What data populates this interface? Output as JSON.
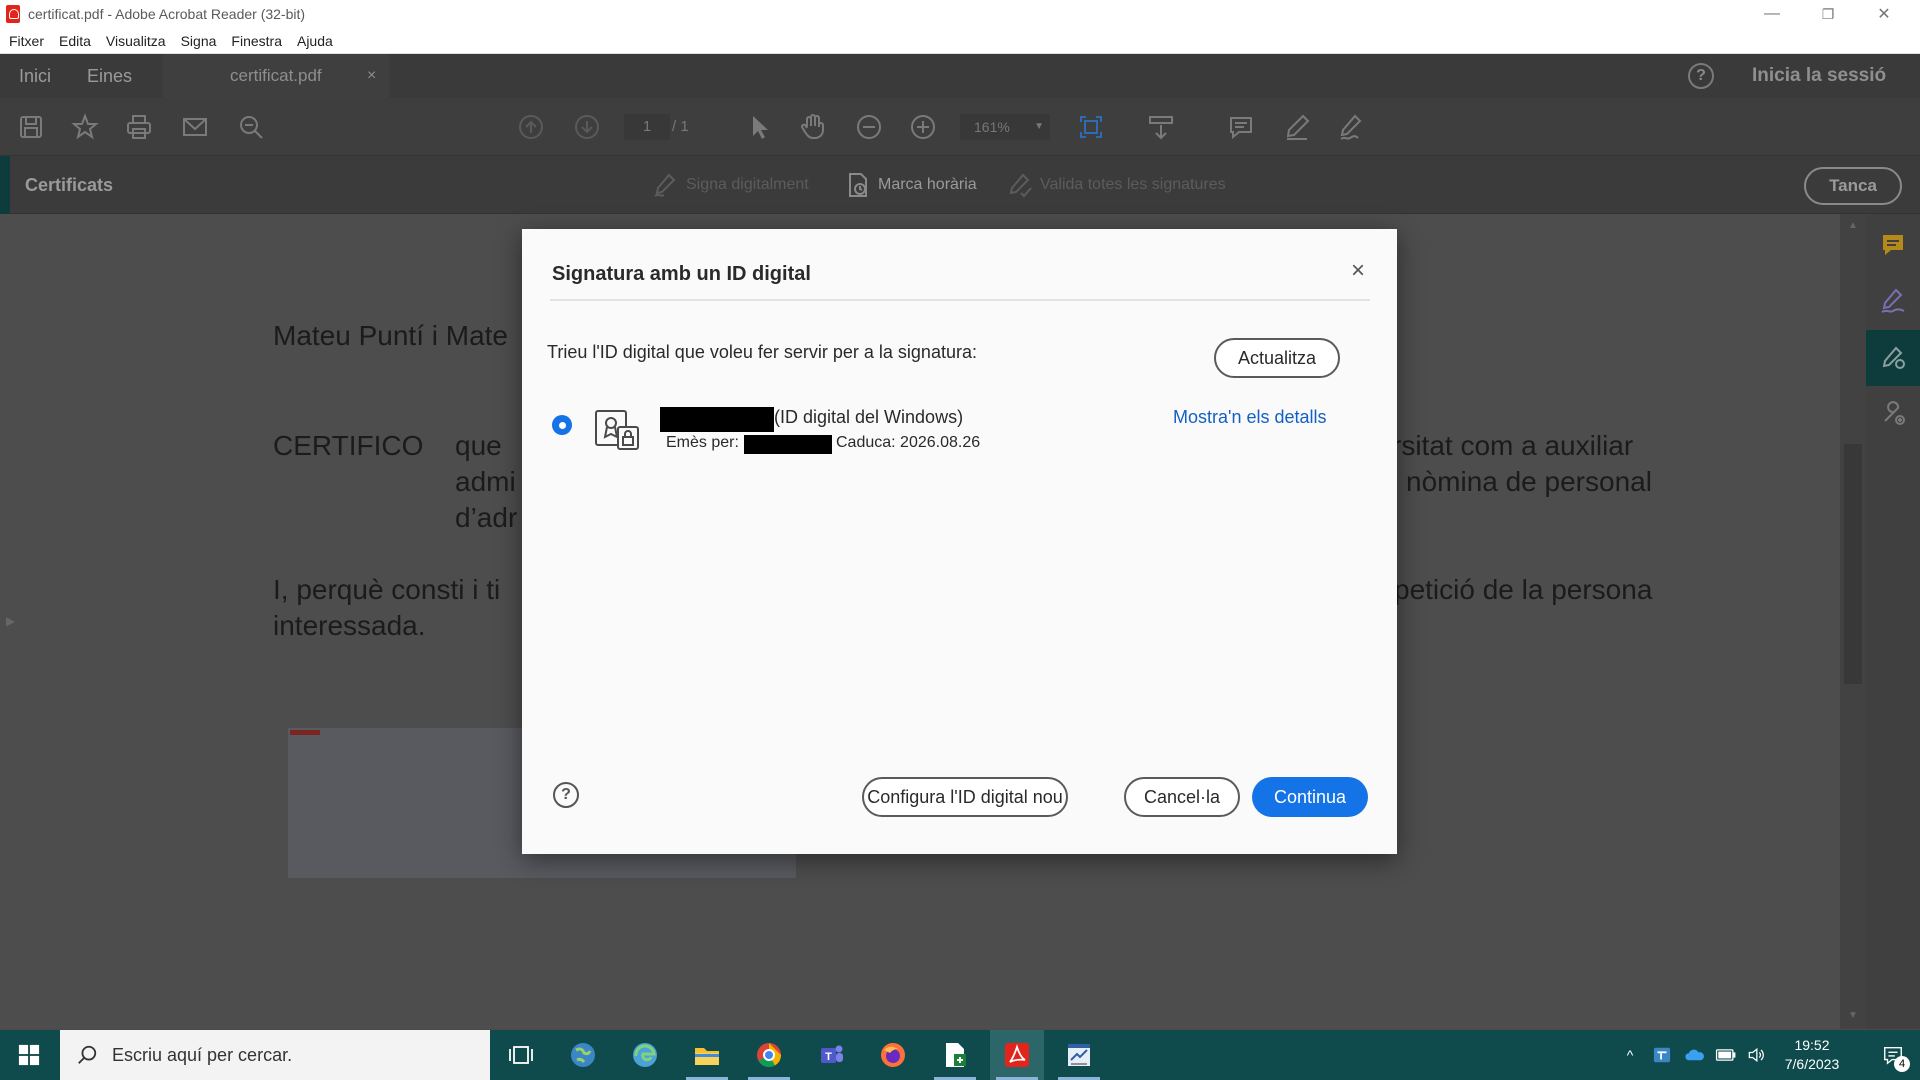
{
  "window": {
    "title": "certificat.pdf - Adobe Acrobat Reader (32-bit)",
    "minimize": "—",
    "maximize": "❐",
    "close": "✕"
  },
  "menu": [
    "Fitxer",
    "Edita",
    "Visualitza",
    "Signa",
    "Finestra",
    "Ajuda"
  ],
  "tabs": {
    "home": "Inici",
    "tools": "Eines",
    "document": "certificat.pdf",
    "document_close": "×",
    "help": "?",
    "signin": "Inicia la sessió"
  },
  "toolbar": {
    "page_current": "1",
    "page_total": "/ 1",
    "zoom": "161%"
  },
  "certbar": {
    "label": "Certificats",
    "sign_digitally": "Signa digitalment",
    "timestamp": "Marca horària",
    "validate_all": "Valida totes les signatures",
    "close": "Tanca"
  },
  "document": {
    "line1": "Mateu Puntí i Mate",
    "certifico": "CERTIFICO",
    "que": "que",
    "right1": "rsitat com a auxiliar",
    "adm": "admi",
    "right2": "nòmina de personal",
    "dadr": "d’adr",
    "perque": "I, perquè consti i ti",
    "right3": "petició de la persona",
    "interessada": "interessada."
  },
  "dialog": {
    "title": "Signatura amb un ID digital",
    "close": "×",
    "prompt": "Trieu l'ID digital que voleu fer servir per a la signatura:",
    "refresh": "Actualitza",
    "cert_type": "(ID digital del Windows)",
    "issuer_label": "Emès per:",
    "expiry": "Caduca: 2026.08.26",
    "details_link": "Mostra'n els detalls",
    "help": "?",
    "configure": "Configura l'ID digital nou",
    "cancel": "Cancel·la",
    "continue": "Continua"
  },
  "taskbar": {
    "search_placeholder": "Escriu aquí per cercar.",
    "time": "19:52",
    "date": "7/6/2023",
    "notification_count": "4"
  },
  "colors": {
    "accent_blue": "#1473e6",
    "link_blue": "#1360c4",
    "taskbar": "#0f4a4c"
  }
}
